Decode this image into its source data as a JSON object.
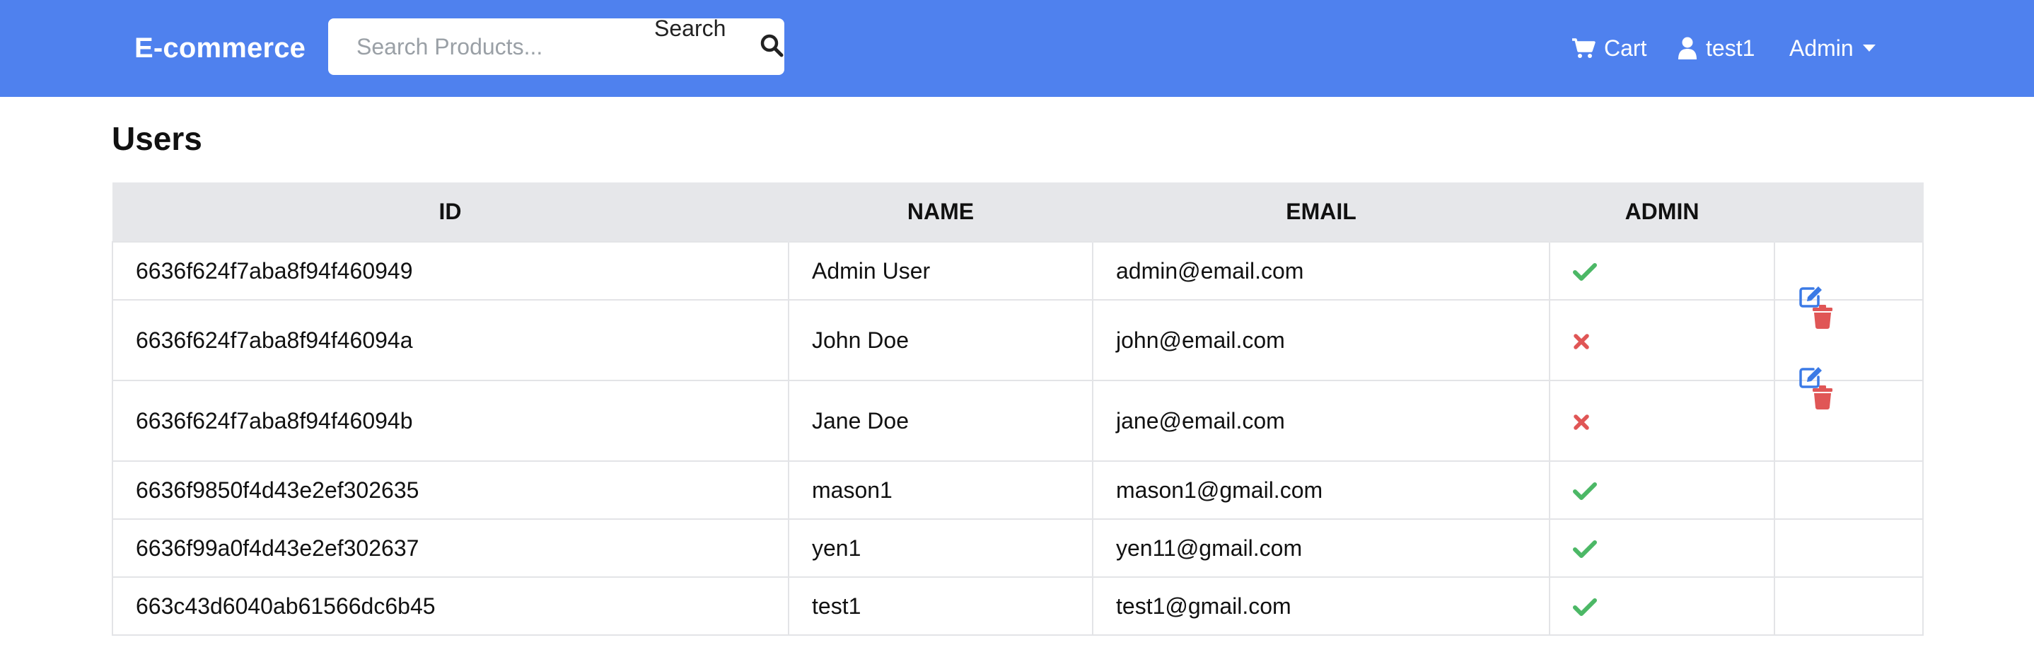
{
  "colors": {
    "navbar_bg": "#4f81ee",
    "check_green": "#4cb866",
    "cross_red": "#e05656",
    "edit_blue": "#3b7ae6",
    "delete_red": "#e05656"
  },
  "navbar": {
    "brand": "E-commerce",
    "search": {
      "placeholder": "Search Products...",
      "value": "",
      "button_label": "Search",
      "icon": "search-icon"
    },
    "cart_label": "Cart",
    "cart_icon": "cart-icon",
    "user_label": "test1",
    "user_icon": "user-icon",
    "admin_label": "Admin",
    "admin_icon": "caret-down-icon"
  },
  "page_title": "Users",
  "table": {
    "headers": [
      "ID",
      "NAME",
      "EMAIL",
      "ADMIN",
      ""
    ],
    "rows": [
      {
        "id": "6636f624f7aba8f94f460949",
        "name": "Admin User",
        "email": "admin@email.com",
        "is_admin": true,
        "actions": false
      },
      {
        "id": "6636f624f7aba8f94f46094a",
        "name": "John Doe",
        "email": "john@email.com",
        "is_admin": false,
        "actions": true
      },
      {
        "id": "6636f624f7aba8f94f46094b",
        "name": "Jane Doe",
        "email": "jane@email.com",
        "is_admin": false,
        "actions": true
      },
      {
        "id": "6636f9850f4d43e2ef302635",
        "name": "mason1",
        "email": "mason1@gmail.com",
        "is_admin": true,
        "actions": false
      },
      {
        "id": "6636f99a0f4d43e2ef302637",
        "name": "yen1",
        "email": "yen11@gmail.com",
        "is_admin": true,
        "actions": false
      },
      {
        "id": "663c43d6040ab61566dc6b45",
        "name": "test1",
        "email": "test1@gmail.com",
        "is_admin": true,
        "actions": false
      }
    ]
  }
}
